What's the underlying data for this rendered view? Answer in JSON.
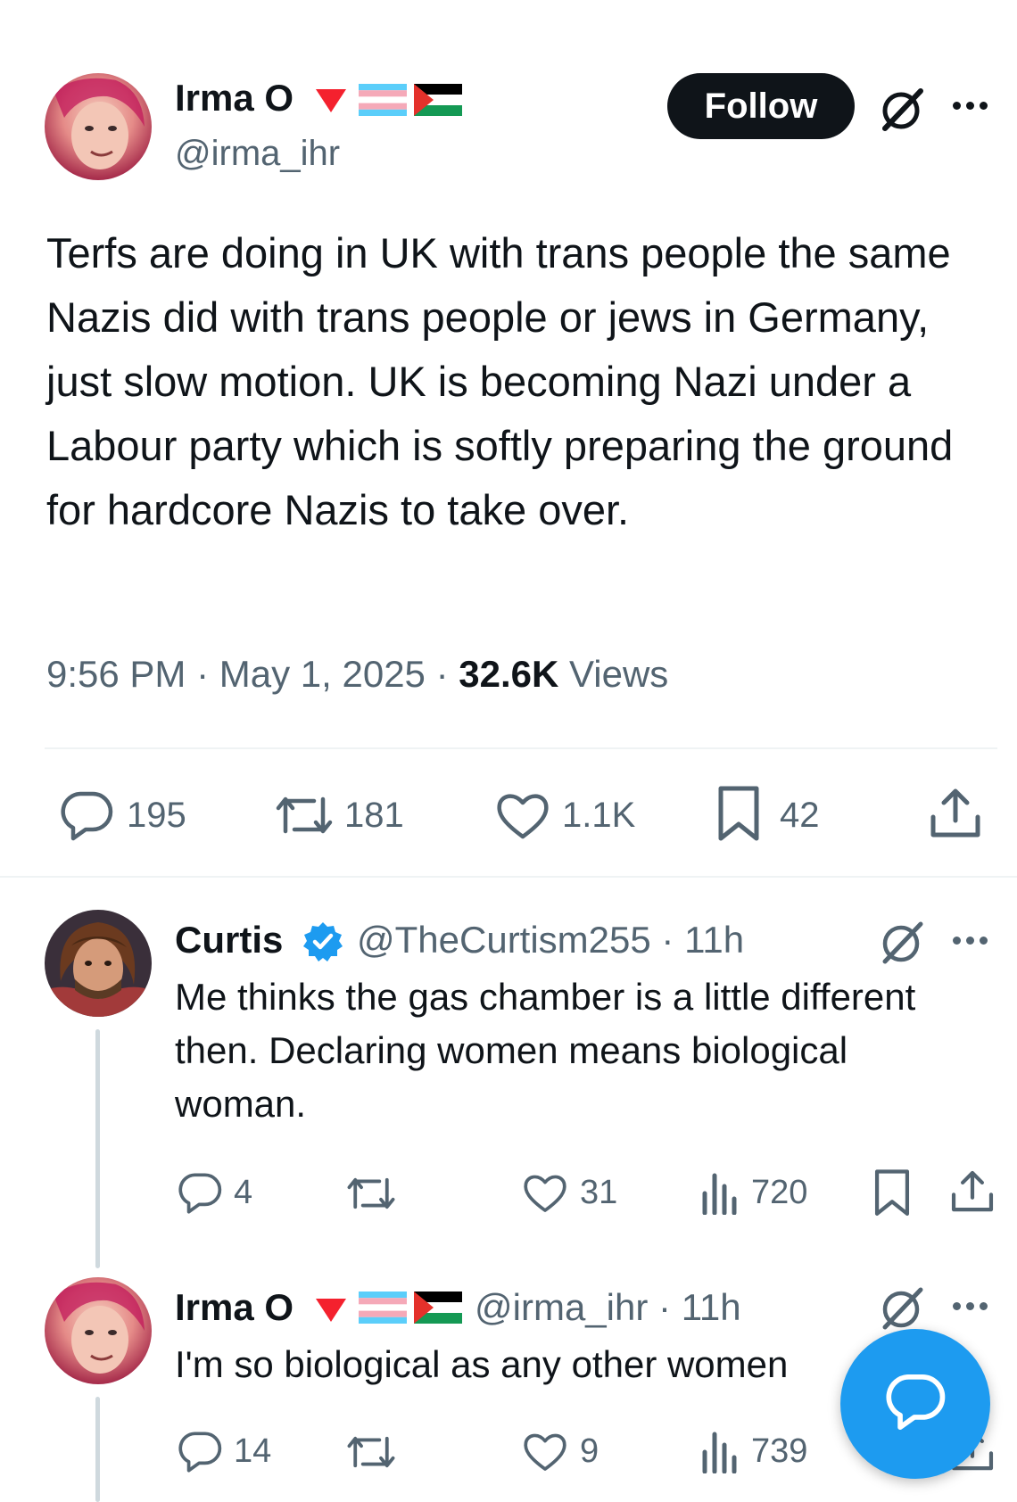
{
  "main_tweet": {
    "author": {
      "name": "Irma O",
      "handle": "@irma_ihr",
      "badge_icons": [
        "down-triangle-icon",
        "trans-flag-icon",
        "palestine-flag-icon"
      ]
    },
    "follow_label": "Follow",
    "text": "Terfs are doing in UK with trans people the same Nazis did with trans people or jews in Germany, just slow motion. UK is becoming Nazi under a Labour party which is softly preparing the ground for hardcore Nazis to take over.",
    "time": "9:56 PM",
    "sep1": "·",
    "date": "May 1, 2025",
    "sep2": "·",
    "views_count": "32.6K",
    "views_label": "Views",
    "actions": {
      "replies": "195",
      "reposts": "181",
      "likes": "1.1K",
      "bookmarks": "42"
    }
  },
  "replies": [
    {
      "author": {
        "name": "Curtis",
        "handle": "@TheCurtism255",
        "time": "11h",
        "sep": "·",
        "verified": true
      },
      "text": "Me thinks the gas chamber is a little different then. Declaring women means biological woman.",
      "actions": {
        "replies": "4",
        "reposts": "",
        "likes": "31",
        "views": "720"
      }
    },
    {
      "author": {
        "name": "Irma O",
        "handle": "@irma_ihr",
        "time": "11h",
        "sep": "·"
      },
      "text": "I'm so biological as any other women",
      "actions": {
        "replies": "14",
        "reposts": "",
        "likes": "9",
        "views": "739"
      }
    }
  ],
  "colors": {
    "text": "#0f1419",
    "secondary": "#536471",
    "accent_blue": "#1d9bf0",
    "follow_bg": "#0f1419",
    "divider": "#eff3f4",
    "badge_red": "#f4212e"
  }
}
